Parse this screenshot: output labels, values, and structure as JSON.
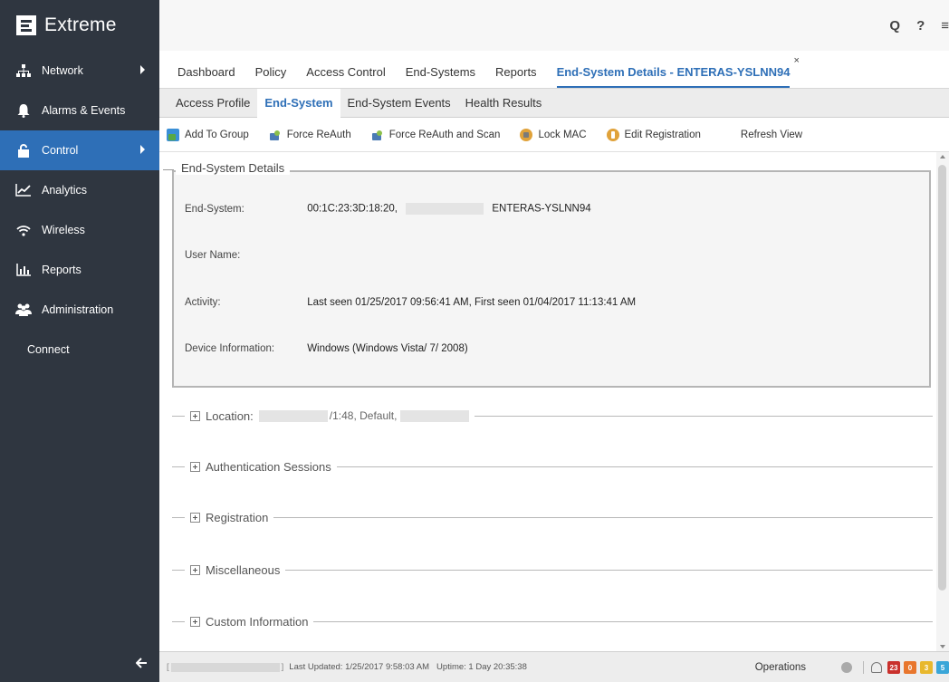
{
  "brand": {
    "name": "Extreme"
  },
  "sidebar": {
    "items": [
      {
        "label": "Network",
        "icon": "network-icon",
        "has_submenu": true
      },
      {
        "label": "Alarms & Events",
        "icon": "bell-icon",
        "has_submenu": false
      },
      {
        "label": "Control",
        "icon": "lock-icon",
        "has_submenu": true,
        "active": true
      },
      {
        "label": "Analytics",
        "icon": "line-chart-icon",
        "has_submenu": false
      },
      {
        "label": "Wireless",
        "icon": "wifi-icon",
        "has_submenu": false
      },
      {
        "label": "Reports",
        "icon": "bar-chart-icon",
        "has_submenu": false
      },
      {
        "label": "Administration",
        "icon": "users-icon",
        "has_submenu": false
      },
      {
        "label": "Connect",
        "icon": "",
        "has_submenu": false
      }
    ],
    "collapse_icon": "arrow-left-icon"
  },
  "topbar": {
    "search_icon": "Q",
    "help_icon": "?",
    "menu_icon": "≡"
  },
  "main_tabs": {
    "items": [
      "Dashboard",
      "Policy",
      "Access Control",
      "End-Systems",
      "Reports",
      "End-System Details - ENTERAS-YSLNN94"
    ],
    "active_index": 5,
    "close_label": "×"
  },
  "sub_tabs": {
    "items": [
      "Access Profile",
      "End-System",
      "End-System Events",
      "Health Results"
    ],
    "active_index": 1
  },
  "toolbar": {
    "add_to_group": "Add To Group",
    "force_reauth": "Force ReAuth",
    "force_reauth_scan": "Force ReAuth and Scan",
    "lock_mac": "Lock MAC",
    "edit_registration": "Edit Registration",
    "refresh_view": "Refresh View"
  },
  "details": {
    "legend": "End-System Details",
    "end_system_label": "End-System:",
    "end_system_mac": "00:1C:23:3D:18:20,",
    "end_system_name": "ENTERAS-YSLNN94",
    "user_name_label": "User Name:",
    "user_name_value": "",
    "activity_label": "Activity:",
    "activity_value": "Last seen 01/25/2017 09:56:41 AM, First seen 01/04/2017 11:13:41 AM",
    "device_info_label": "Device Information:",
    "device_info_value": "Windows (Windows Vista/ 7/ 2008)"
  },
  "sections": {
    "location_label": "Location:",
    "location_value": "/1:48, Default,",
    "auth_sessions": "Authentication Sessions",
    "registration": "Registration",
    "miscellaneous": "Miscellaneous",
    "custom_information": "Custom Information"
  },
  "statusbar": {
    "bracket_open": "[",
    "bracket_close": "]",
    "last_updated": "Last Updated: 1/25/2017 9:58:03 AM",
    "uptime": "Uptime: 1 Day 20:35:38",
    "operations": "Operations",
    "badges": [
      {
        "value": "23",
        "color": "#c9302c"
      },
      {
        "value": "0",
        "color": "#e8762d"
      },
      {
        "value": "3",
        "color": "#e8b82d"
      },
      {
        "value": "5",
        "color": "#3aa6d8"
      }
    ]
  },
  "colors": {
    "sidebar_bg": "#2f3640",
    "accent": "#2e6fb7"
  }
}
